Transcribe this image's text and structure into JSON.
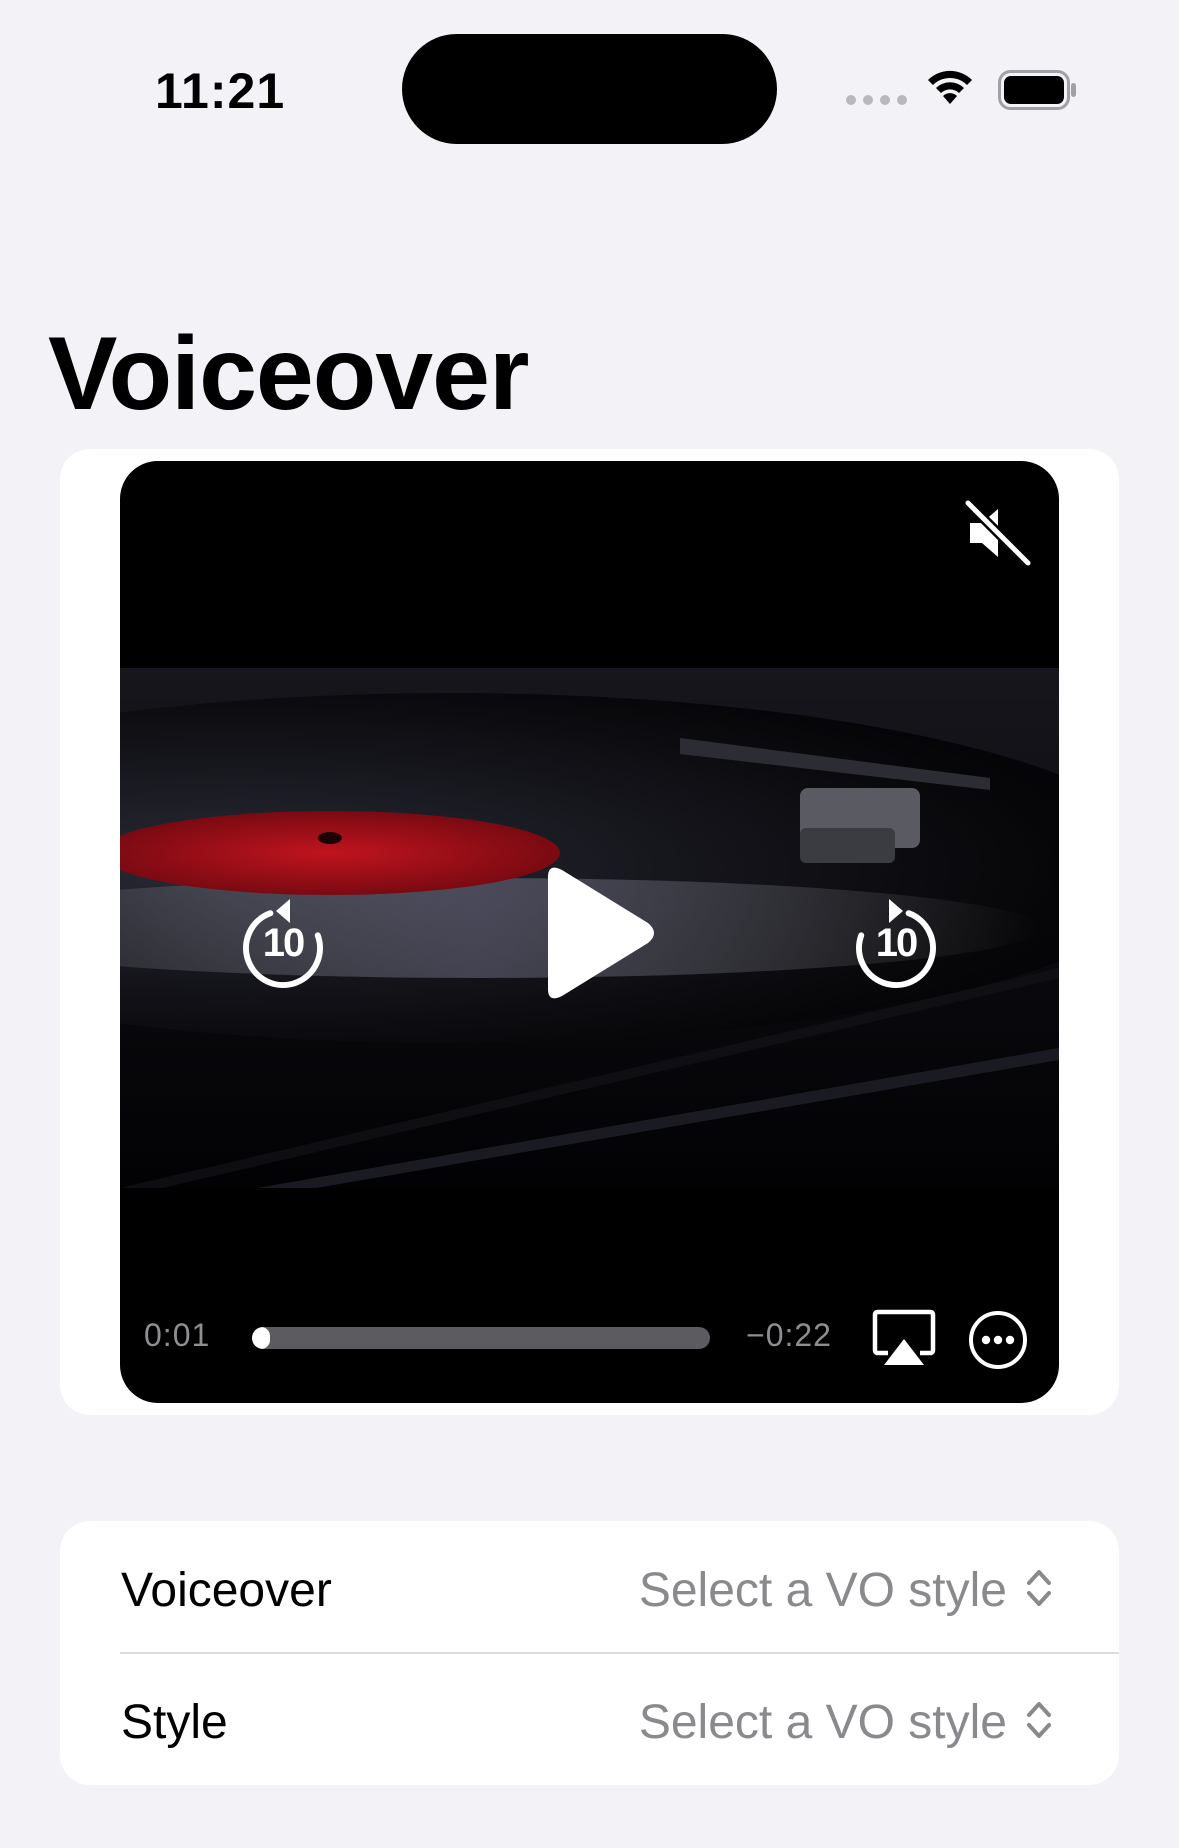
{
  "status_bar": {
    "time": "11:21"
  },
  "page": {
    "title": "Voiceover"
  },
  "player": {
    "elapsed": "0:01",
    "remaining": "−0:22",
    "progress_fraction": 0.04,
    "skip_back_seconds": "10",
    "skip_forward_seconds": "10",
    "icons": [
      "speaker-muted-icon",
      "play-icon",
      "skip-back-10-icon",
      "skip-forward-10-icon",
      "airplay-icon",
      "ellipsis-circle-icon"
    ]
  },
  "form": {
    "rows": [
      {
        "label": "Voiceover",
        "value": "Select a VO style"
      },
      {
        "label": "Style",
        "value": "Select a VO style"
      }
    ]
  },
  "colors": {
    "background": "#f2f2f7",
    "card": "#ffffff",
    "secondary_text": "#8a8a8e",
    "record_label": "#b0121c"
  }
}
